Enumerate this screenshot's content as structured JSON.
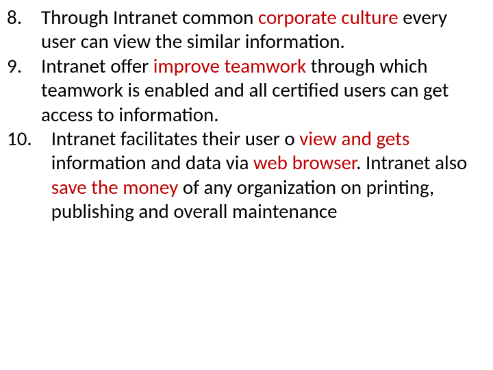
{
  "items": [
    {
      "num": "8. ",
      "spans": [
        {
          "t": "Through Intranet common ",
          "c": "blk"
        },
        {
          "t": "corporate culture",
          "c": "red"
        },
        {
          "t": " every user can view the similar information.",
          "c": "blk"
        }
      ]
    },
    {
      "num": "9. ",
      "spans": [
        {
          "t": "Intranet offer ",
          "c": "blk"
        },
        {
          "t": "improve teamwork",
          "c": "red"
        },
        {
          "t": " through which teamwork is enabled and all certified users can get access to information.",
          "c": "blk"
        }
      ]
    },
    {
      "num": "10.",
      "spans": [
        {
          "t": "Intranet facilitates their user o ",
          "c": "blk"
        },
        {
          "t": "view and gets ",
          "c": "red"
        },
        {
          "t": "information and data via ",
          "c": "blk"
        },
        {
          "t": "web browser",
          "c": "red"
        },
        {
          "t": ". Intranet also ",
          "c": "blk"
        },
        {
          "t": "save the money",
          "c": "red"
        },
        {
          "t": " of any organization on printing, publishing and overall maintenance",
          "c": "blk"
        }
      ]
    }
  ]
}
